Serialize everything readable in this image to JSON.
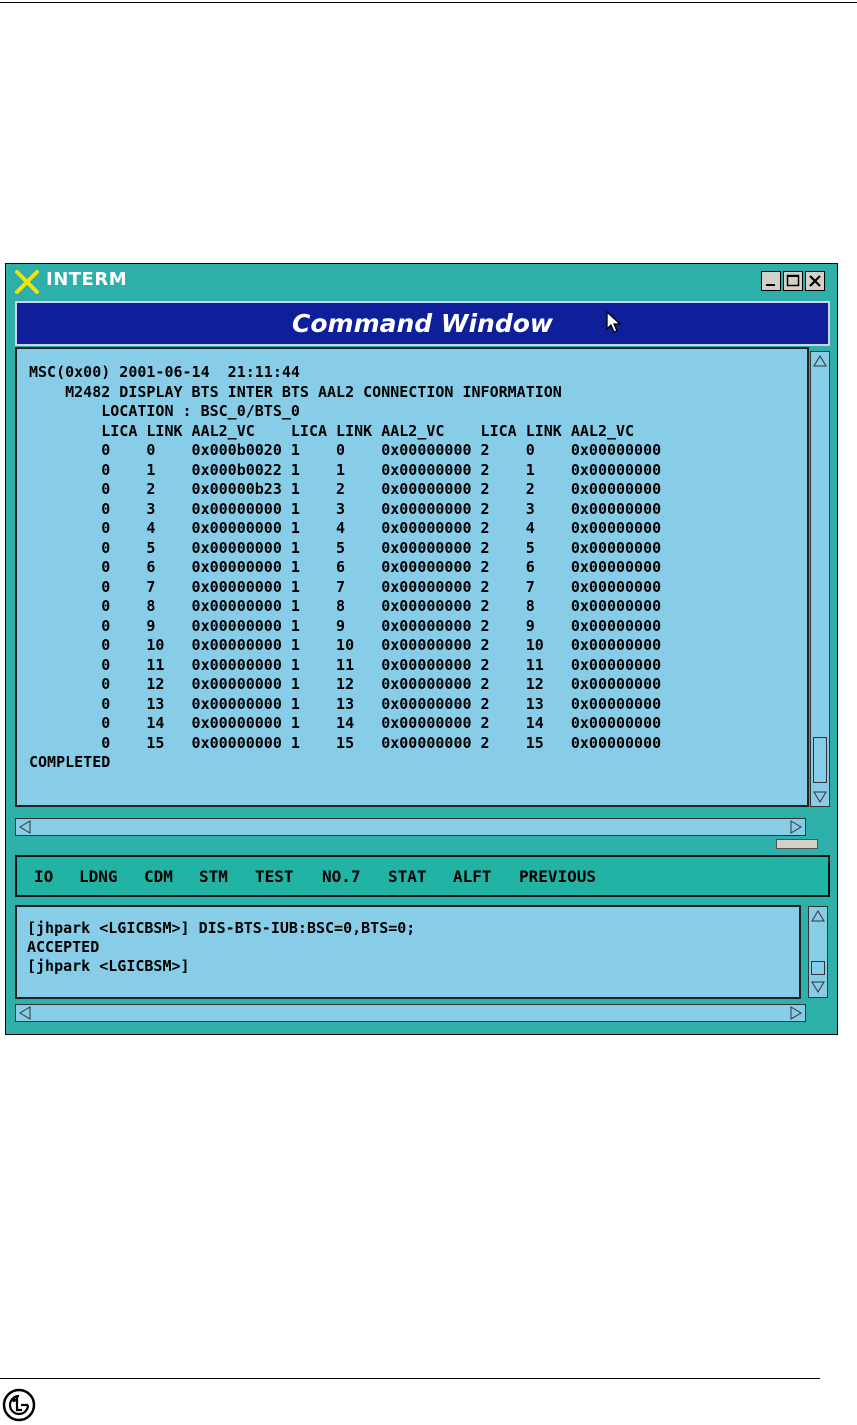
{
  "window": {
    "title": "INTERM",
    "panel_title": "Command Window"
  },
  "output": {
    "lines": [
      "MSC(0x00) 2001-06-14  21:11:44",
      "    M2482 DISPLAY BTS INTER BTS AAL2 CONNECTION INFORMATION",
      "        LOCATION : BSC_0/BTS_0",
      "        LICA LINK AAL2_VC    LICA LINK AAL2_VC    LICA LINK AAL2_VC",
      "        0    0    0x000b0020 1    0    0x00000000 2    0    0x00000000",
      "        0    1    0x000b0022 1    1    0x00000000 2    1    0x00000000",
      "        0    2    0x00000b23 1    2    0x00000000 2    2    0x00000000",
      "        0    3    0x00000000 1    3    0x00000000 2    3    0x00000000",
      "        0    4    0x00000000 1    4    0x00000000 2    4    0x00000000",
      "        0    5    0x00000000 1    5    0x00000000 2    5    0x00000000",
      "        0    6    0x00000000 1    6    0x00000000 2    6    0x00000000",
      "        0    7    0x00000000 1    7    0x00000000 2    7    0x00000000",
      "        0    8    0x00000000 1    8    0x00000000 2    8    0x00000000",
      "        0    9    0x00000000 1    9    0x00000000 2    9    0x00000000",
      "        0    10   0x00000000 1    10   0x00000000 2    10   0x00000000",
      "        0    11   0x00000000 1    11   0x00000000 2    11   0x00000000",
      "        0    12   0x00000000 1    12   0x00000000 2    12   0x00000000",
      "        0    13   0x00000000 1    13   0x00000000 2    13   0x00000000",
      "        0    14   0x00000000 1    14   0x00000000 2    14   0x00000000",
      "        0    15   0x00000000 1    15   0x00000000 2    15   0x00000000",
      "COMPLETED"
    ]
  },
  "menu": {
    "items": [
      {
        "label": "IO"
      },
      {
        "label": "LDNG"
      },
      {
        "label": "CDM"
      },
      {
        "label": "STM"
      },
      {
        "label": "TEST"
      },
      {
        "label": "NO.7"
      },
      {
        "label": "STAT"
      },
      {
        "label": "ALFT"
      },
      {
        "label": "PREVIOUS"
      }
    ]
  },
  "input": {
    "lines": [
      "[jhpark <LGICBSM>] DIS-BTS-IUB:BSC=0,BTS=0;",
      "ACCEPTED",
      "[jhpark <LGICBSM>]"
    ]
  },
  "icons": {
    "app": "x-app-icon",
    "minimize": "minimize-icon",
    "maximize": "maximize-icon",
    "close": "close-icon",
    "cursor": "cursor-icon",
    "logo": "lg-logo-icon"
  },
  "colors": {
    "titlebar": "#2db0a9",
    "header": "#0f1f9a",
    "panel": "#87cde8",
    "menubar": "#21b3a4"
  }
}
